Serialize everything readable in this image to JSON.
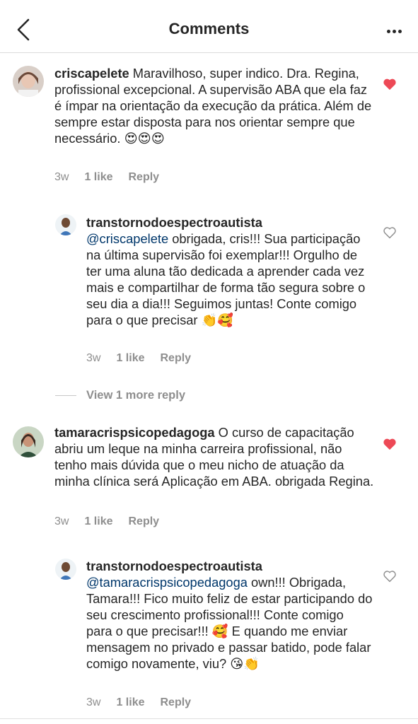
{
  "header": {
    "title": "Comments"
  },
  "comments": [
    {
      "username": "criscapelete",
      "text": " Maravilhoso, super indico. Dra. Regina, profissional excepcional. A supervisão ABA que ela faz é  ímpar na orientação da execução da prática. Além de sempre estar disposta para nos orientar sempre que necessário. ",
      "emoji": "😍😍😍",
      "time": "3w",
      "likes": "1 like",
      "reply": "Reply",
      "liked": true
    },
    {
      "username": "transtornodoespectroautista",
      "mention": "@criscapelete",
      "text": " obrigada, cris!!! Sua participação na última supervisão foi exemplar!!! Orgulho de ter uma aluna tão dedicada a aprender cada vez mais e compartilhar de forma tão segura sobre o seu dia a dia!!! Seguimos juntas! Conte comigo para o que precisar ",
      "emoji": "👏🥰",
      "time": "3w",
      "likes": "1 like",
      "reply": "Reply",
      "liked": false
    },
    {
      "username": "tamaracrispsicopedagoga",
      "text": " O curso de capacitação abriu um leque na minha carreira profissional, não tenho mais dúvida que o meu nicho de atuação da minha clínica será Aplicação em ABA. obrigada Regina.",
      "time": "3w",
      "likes": "1 like",
      "reply": "Reply",
      "liked": true
    },
    {
      "username": "transtornodoespectroautista",
      "mention": "@tamaracrispsicopedagoga",
      "text": " own!!! Obrigada, Tamara!!! Fico muito feliz de estar participando do seu crescimento profissional!!! Conte comigo para o que precisar!!! 🥰 E quando me enviar mensagem no privado e passar batido, pode falar comigo novamente, viu? ",
      "emoji": "😘👏",
      "time": "3w",
      "likes": "1 like",
      "reply": "Reply",
      "liked": false
    }
  ],
  "view_more": "View 1 more reply",
  "colors": {
    "heart": "#ed4956",
    "mention": "#00376b",
    "meta": "#8e8e8e"
  }
}
